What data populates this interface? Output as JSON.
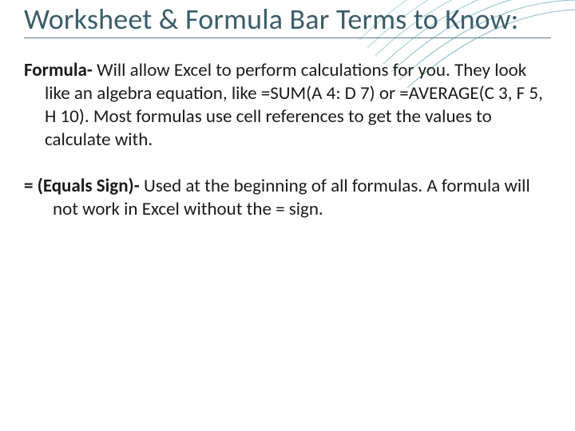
{
  "title": "Worksheet & Formula Bar Terms to Know:",
  "items": [
    {
      "term": "Formula-",
      "def": "  Will allow Excel to perform calculations for you. They look like an algebra equation, like =SUM(A 4: D 7) or =AVERAGE(C 3, F 5, H 10). Most formulas use cell references to get the values to calculate with."
    },
    {
      "term": "= (Equals Sign)-",
      "def": " Used at the beginning of all formulas. A formula will not work in Excel without the = sign."
    }
  ]
}
